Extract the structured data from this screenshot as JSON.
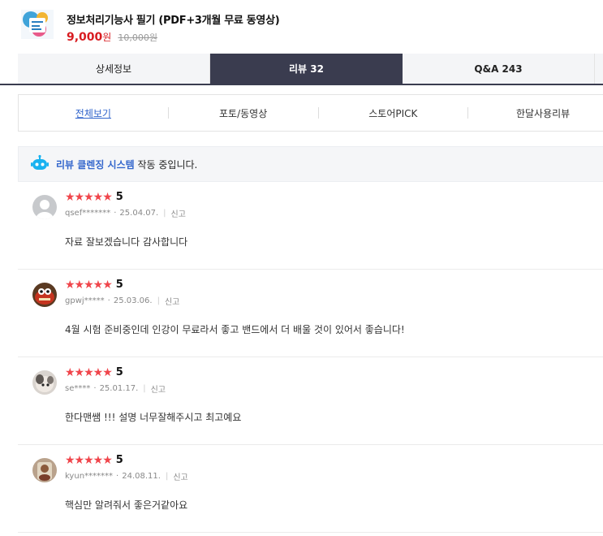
{
  "product": {
    "title": "정보처리기능사 필기 (PDF+3개월 무료 동영상)",
    "price": "9,000",
    "price_unit": "원",
    "original_price": "10,000원"
  },
  "tabs": [
    {
      "label": "상세정보"
    },
    {
      "label": "리뷰 32"
    },
    {
      "label": "Q&A 243"
    }
  ],
  "filters": [
    {
      "label": "전체보기"
    },
    {
      "label": "포토/동영상"
    },
    {
      "label": "스토어PICK"
    },
    {
      "label": "한달사용리뷰"
    }
  ],
  "notice": {
    "link": "리뷰 클렌징 시스템",
    "rest": " 작동 중입니다."
  },
  "colors": {
    "accent": "#3366cc",
    "price": "#d81c21",
    "star": "#f0454b",
    "tab_active": "#3a3c4f"
  },
  "reviews": [
    {
      "score": "5",
      "user": "qsef*******",
      "date": "25.04.07.",
      "report": "신고",
      "text": "자료 잘보겠습니다 감사합니다"
    },
    {
      "score": "5",
      "user": "gpwj*****",
      "date": "25.03.06.",
      "report": "신고",
      "text": "4월 시험 준비중인데 인강이 무료라서 좋고 밴드에서 더 배울 것이 있어서 좋습니다!"
    },
    {
      "score": "5",
      "user": "se****",
      "date": "25.01.17.",
      "report": "신고",
      "text": "한다맨쌤 !!! 설명 너무잘해주시고 최고예요"
    },
    {
      "score": "5",
      "user": "kyun*******",
      "date": "24.08.11.",
      "report": "신고",
      "text": "핵심만 알려줘서 좋은거같아요"
    }
  ]
}
